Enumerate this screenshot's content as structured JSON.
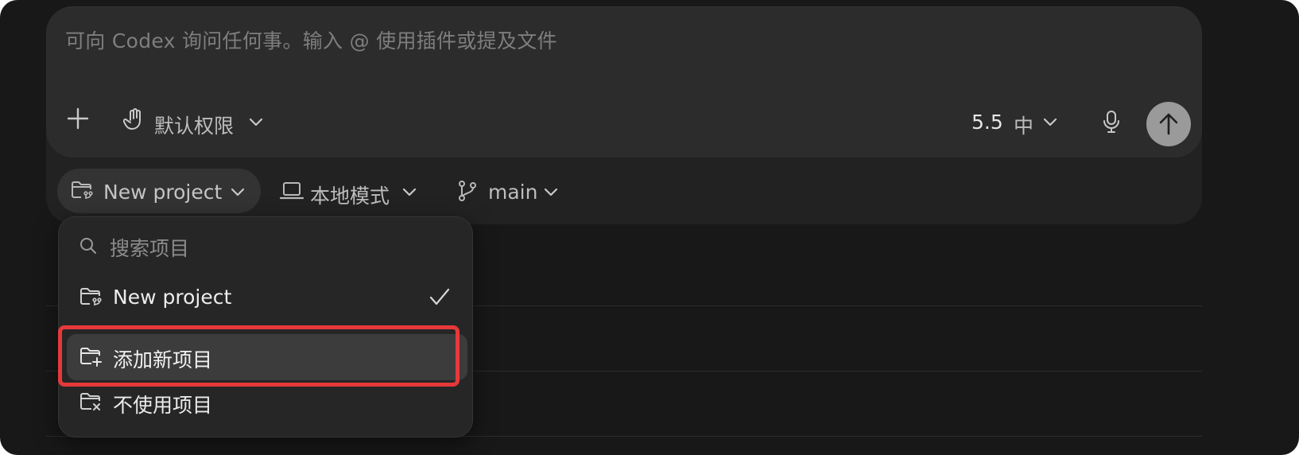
{
  "composer": {
    "placeholder": "可向 Codex 询问任何事。输入 @ 使用插件或提及文件",
    "permissions_label": "默认权限",
    "model_label": "5.5",
    "effort_label": "中"
  },
  "context_bar": {
    "project_label": "New project",
    "mode_label": "本地模式",
    "branch_label": "main"
  },
  "project_menu": {
    "search_placeholder": "搜索项目",
    "items": [
      {
        "label": "New project",
        "selected": true
      },
      {
        "label": "添加新项目",
        "highlighted": true
      },
      {
        "label": "不使用项目"
      }
    ]
  },
  "colors": {
    "background": "#181818",
    "composer": "#2c2c2c",
    "highlight_outline": "#e5393a",
    "send_button": "#9a9a9a"
  },
  "icons": [
    "plus-icon",
    "hand-icon",
    "chevron-down-icon",
    "microphone-icon",
    "arrow-up-icon",
    "folder-branch-icon",
    "laptop-icon",
    "git-branch-icon",
    "search-icon",
    "check-icon",
    "folder-plus-icon",
    "folder-x-icon"
  ]
}
